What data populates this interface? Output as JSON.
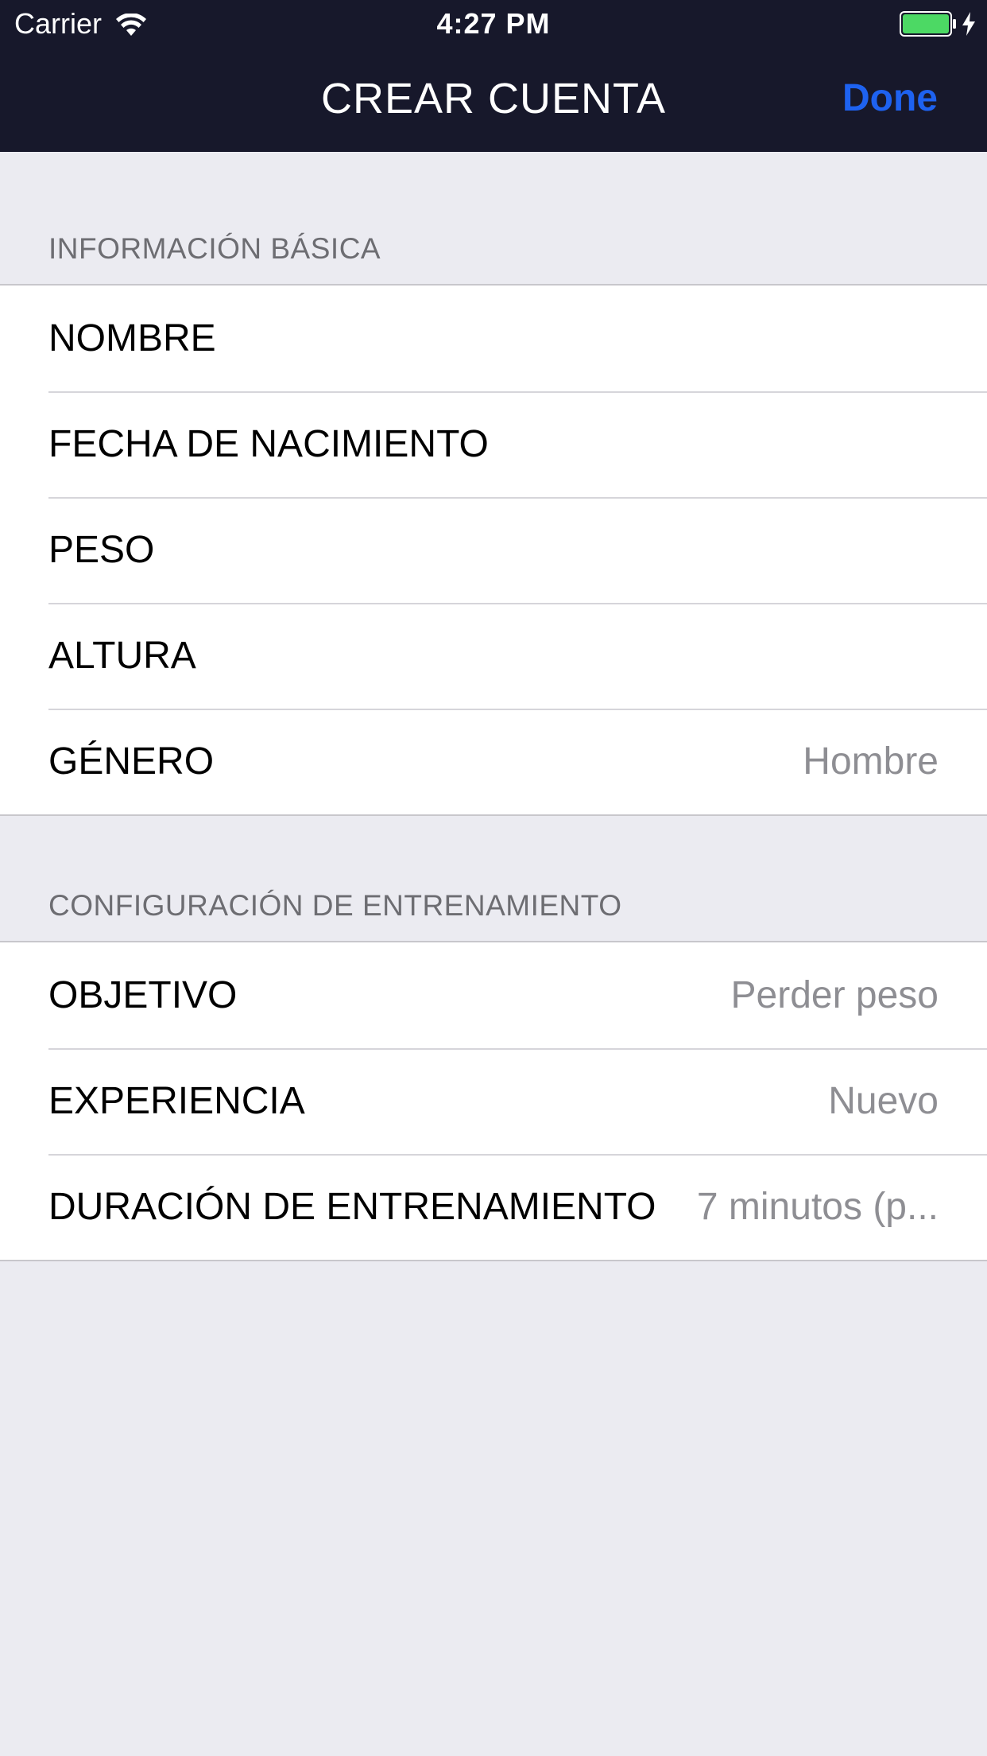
{
  "status_bar": {
    "carrier": "Carrier",
    "time": "4:27 PM",
    "battery_color": "#4CD964"
  },
  "nav_bar": {
    "title": "CREAR CUENTA",
    "done_label": "Done",
    "background": "#17182B",
    "done_color": "#1E62F0"
  },
  "basic_info": {
    "header": "INFORMACIÓN BÁSICA",
    "rows": [
      {
        "label": "NOMBRE",
        "value": ""
      },
      {
        "label": "FECHA DE NACIMIENTO",
        "value": ""
      },
      {
        "label": "PESO",
        "value": ""
      },
      {
        "label": "ALTURA",
        "value": ""
      },
      {
        "label": "GÉNERO",
        "value": "Hombre"
      }
    ]
  },
  "training_config": {
    "header": "CONFIGURACIÓN DE ENTRENAMIENTO",
    "rows": [
      {
        "label": "OBJETIVO",
        "value": "Perder peso"
      },
      {
        "label": "EXPERIENCIA",
        "value": "Nuevo"
      },
      {
        "label": "DURACIÓN DE ENTRENAMIENTO",
        "value": "7 minutos (p..."
      }
    ]
  },
  "icons": {
    "wifi": "wifi-icon",
    "battery": "battery-icon",
    "charging": "charging-bolt-icon"
  }
}
